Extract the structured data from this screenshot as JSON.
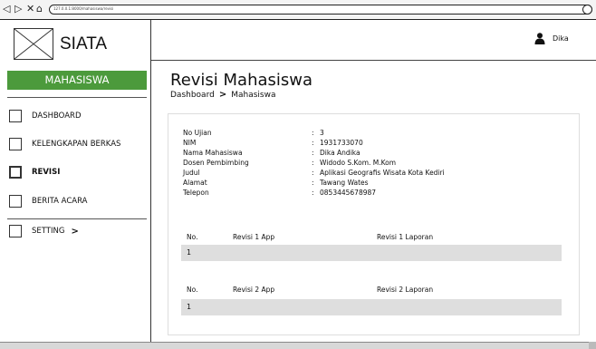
{
  "browser": {
    "url": "127.0.0.1:8000/mahasiswa/revisi",
    "icons": [
      "back-arrow-icon",
      "forward-arrow-icon",
      "close-icon",
      "home-icon"
    ]
  },
  "sidebar": {
    "app_name": "SIATA",
    "logo_icon": "image-placeholder-icon",
    "role": "MAHASISWA",
    "role_color": "#4c9a3c",
    "menu": [
      {
        "label": "DASHBOARD",
        "active": false
      },
      {
        "label": "KELENGKAPAN BERKAS",
        "active": false
      },
      {
        "label": "REVISI",
        "active": true
      },
      {
        "label": "BERITA ACARA",
        "active": false
      },
      {
        "label": "SETTING",
        "active": false,
        "icon": "chevron-right-icon"
      }
    ]
  },
  "header": {
    "user_icon": "user-icon",
    "user_name": "Dika"
  },
  "main": {
    "title": "Revisi Mahasiswa",
    "breadcrumb": [
      "Dashboard",
      "Mahasiswa"
    ],
    "breadcrumb_separator_icon": "chevron-right-icon",
    "info": [
      {
        "label": "No Ujian",
        "value": "3"
      },
      {
        "label": "NIM",
        "value": "1931733070"
      },
      {
        "label": "Nama Mahasiswa",
        "value": "Dika Andika"
      },
      {
        "label": "Dosen Pembimbing",
        "value": "Widodo S.Kom. M.Kom"
      },
      {
        "label": "Judul",
        "value": "Aplikasi Geografis Wisata Kota Kediri"
      },
      {
        "label": "Alamat",
        "value": "Tawang Wates"
      },
      {
        "label": "Telepon",
        "value": "0853445678987"
      }
    ],
    "table1": {
      "headers": [
        "No.",
        "Revisi 1 App",
        "Revisi 1 Laporan"
      ],
      "rows": [
        [
          "1",
          "",
          ""
        ]
      ]
    },
    "table2": {
      "headers": [
        "No.",
        "Revisi 2 App",
        "Revisi 2 Laporan"
      ],
      "rows": [
        [
          "1",
          "",
          ""
        ]
      ]
    }
  }
}
